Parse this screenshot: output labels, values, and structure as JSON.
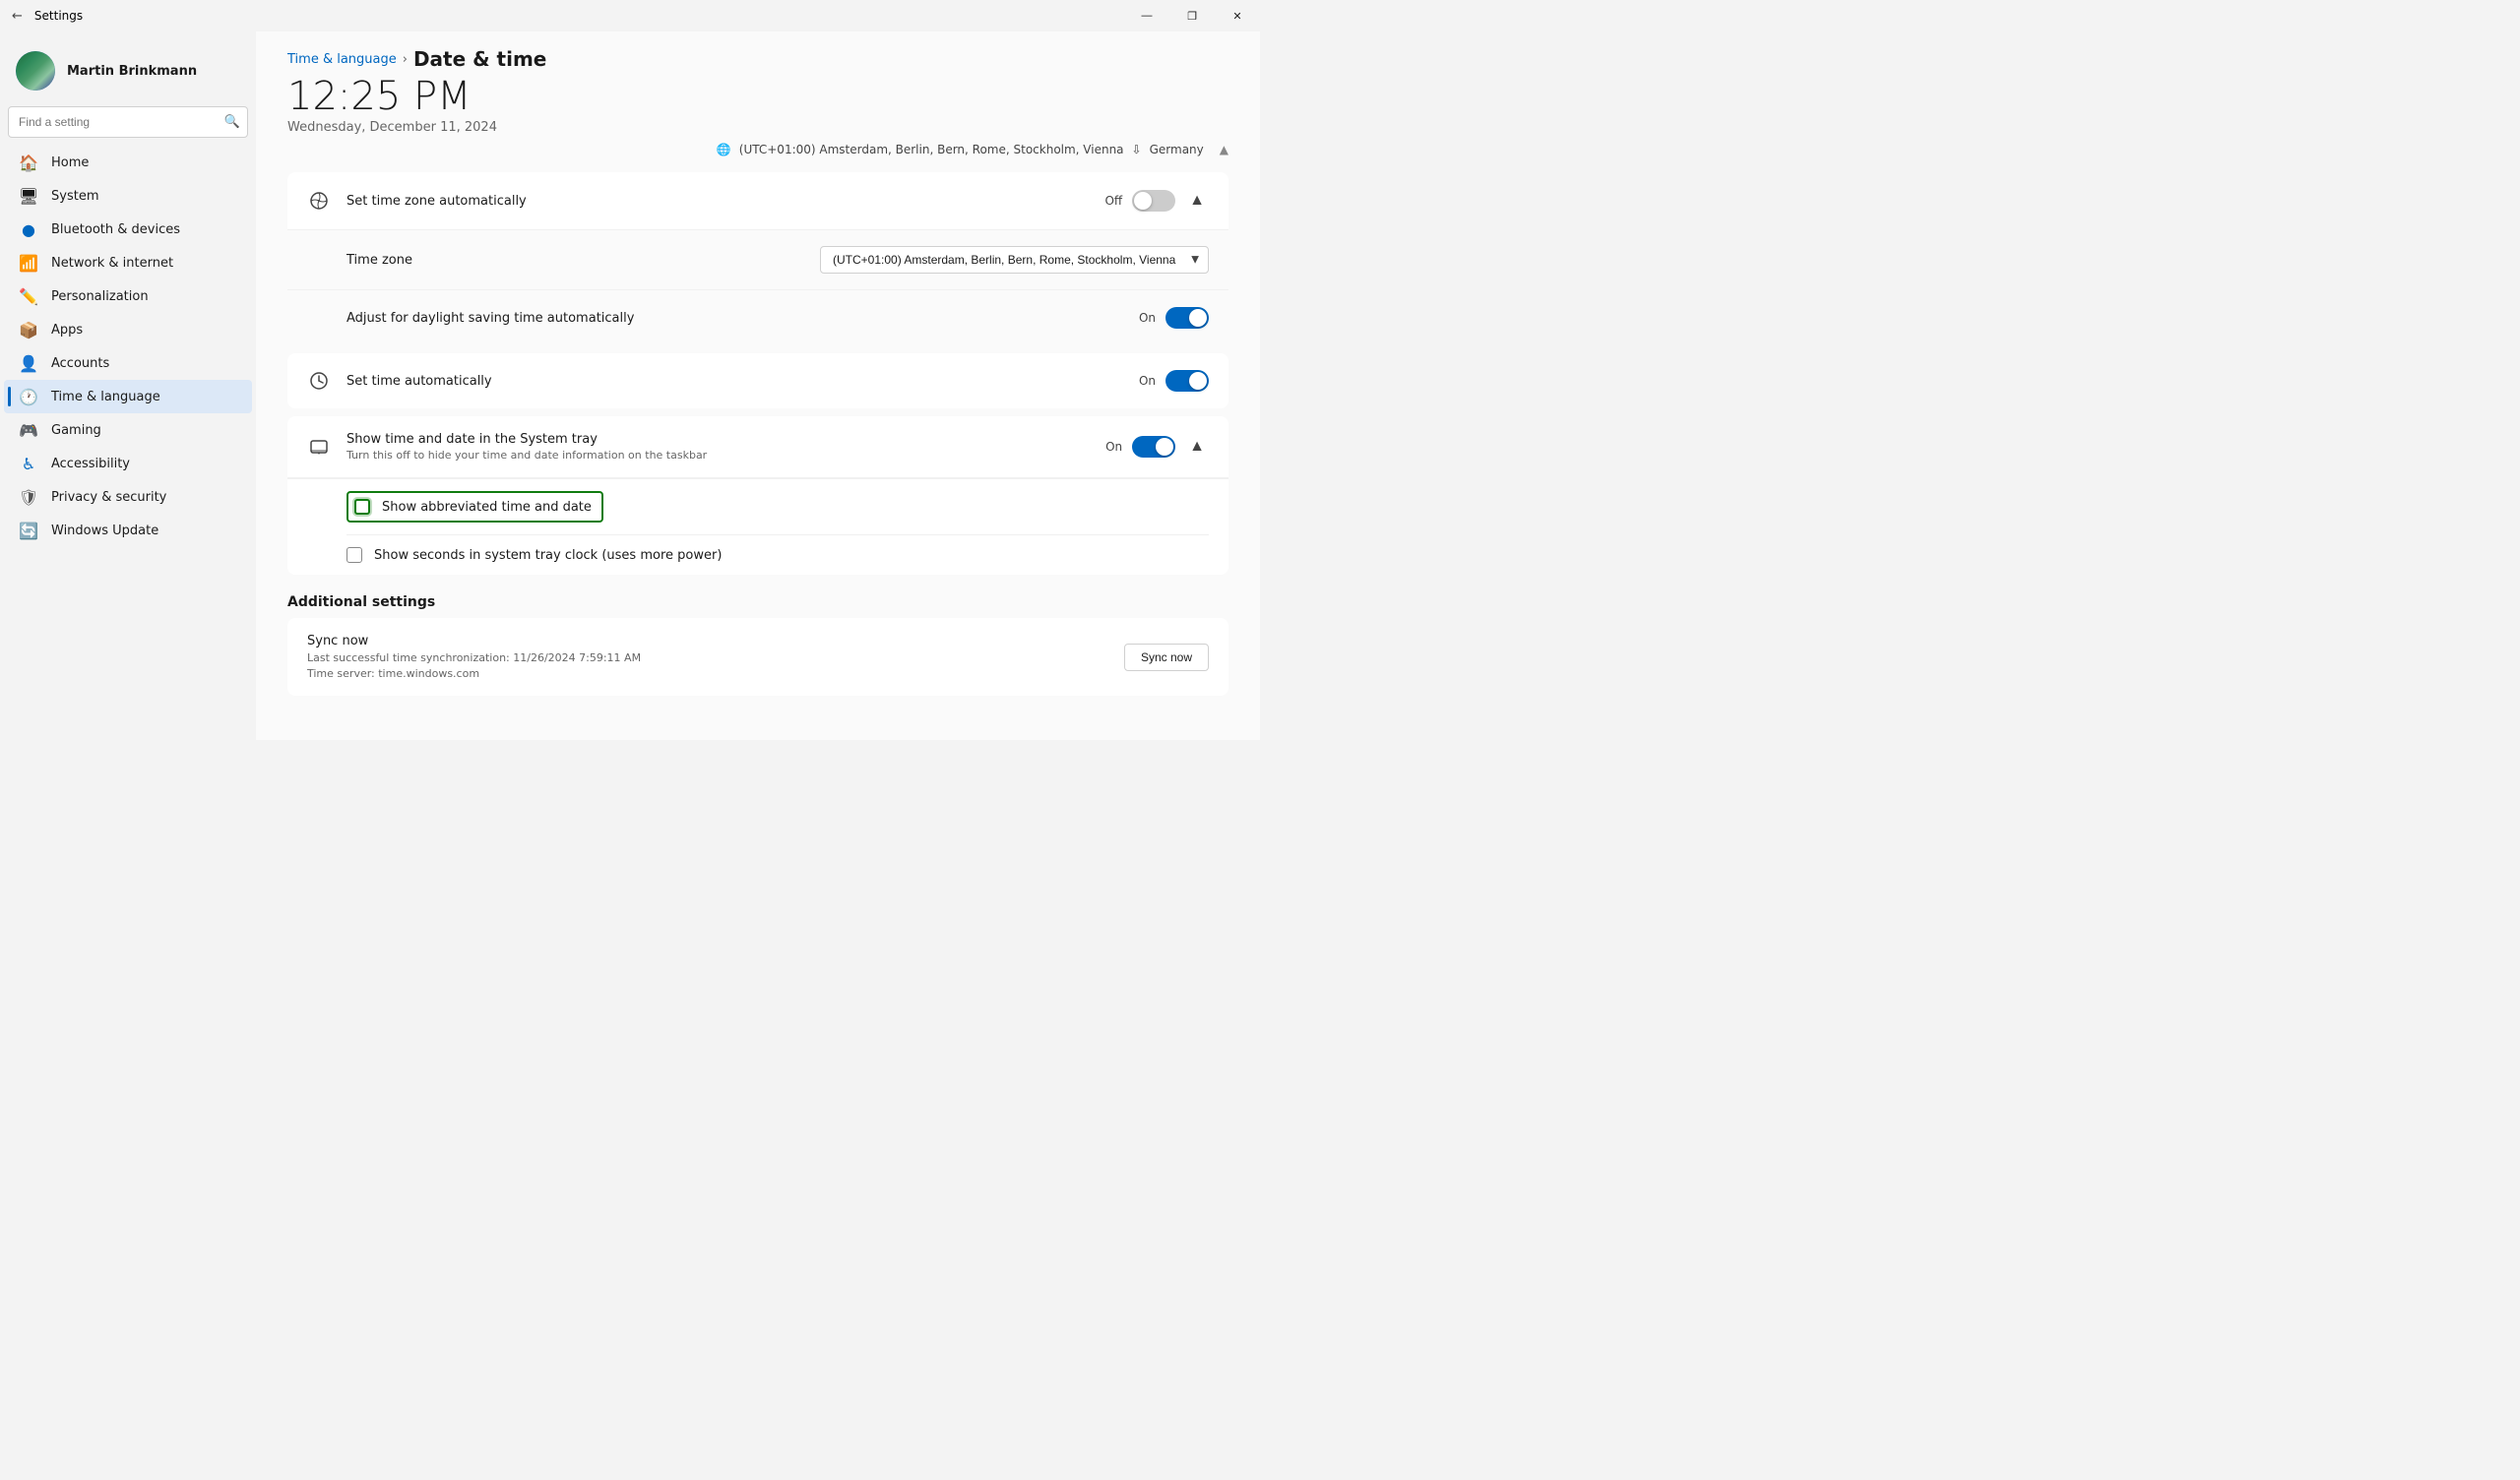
{
  "titlebar": {
    "title": "Settings",
    "minimize": "—",
    "maximize": "❐",
    "close": "✕"
  },
  "user": {
    "name": "Martin Brinkmann"
  },
  "search": {
    "placeholder": "Find a setting"
  },
  "nav": {
    "items": [
      {
        "id": "home",
        "label": "Home",
        "icon": "🏠"
      },
      {
        "id": "system",
        "label": "System",
        "icon": "🖥"
      },
      {
        "id": "bluetooth",
        "label": "Bluetooth & devices",
        "icon": "🔵"
      },
      {
        "id": "network",
        "label": "Network & internet",
        "icon": "📶"
      },
      {
        "id": "personalization",
        "label": "Personalization",
        "icon": "✏️"
      },
      {
        "id": "apps",
        "label": "Apps",
        "icon": "📦"
      },
      {
        "id": "accounts",
        "label": "Accounts",
        "icon": "👤"
      },
      {
        "id": "time-language",
        "label": "Time & language",
        "icon": "🕐",
        "active": true
      },
      {
        "id": "gaming",
        "label": "Gaming",
        "icon": "🎮"
      },
      {
        "id": "accessibility",
        "label": "Accessibility",
        "icon": "♿"
      },
      {
        "id": "privacy-security",
        "label": "Privacy & security",
        "icon": "🛡"
      },
      {
        "id": "windows-update",
        "label": "Windows Update",
        "icon": "🔄"
      }
    ]
  },
  "breadcrumb": {
    "parent": "Time & language",
    "current": "Date & time"
  },
  "header": {
    "current_time": "12:25 PM",
    "current_date": "Wednesday, December 11, 2024",
    "timezone_label": "(UTC+01:00) Amsterdam, Berlin, Bern, Rome, Stockholm, Vienna",
    "region_label": "Germany"
  },
  "settings": {
    "set_time_zone_auto": {
      "label": "Set time zone automatically",
      "status": "Off",
      "on": false
    },
    "time_zone": {
      "label": "Time zone",
      "value": "(UTC+01:00) Amsterdam, Berlin, Bern, Rome, Stockholm, Vienna"
    },
    "daylight_saving": {
      "label": "Adjust for daylight saving time automatically",
      "status": "On",
      "on": true
    },
    "set_time_auto": {
      "label": "Set time automatically",
      "status": "On",
      "on": true
    },
    "system_tray": {
      "label": "Show time and date in the System tray",
      "desc": "Turn this off to hide your time and date information on the taskbar",
      "status": "On",
      "on": true
    },
    "abbreviated_time": {
      "label": "Show abbreviated time and date",
      "checked": false,
      "highlighted": true
    },
    "show_seconds": {
      "label": "Show seconds in system tray clock (uses more power)",
      "checked": false
    }
  },
  "additional": {
    "title": "Additional settings",
    "sync": {
      "title": "Sync now",
      "desc1": "Last successful time synchronization: 11/26/2024 7:59:11 AM",
      "desc2": "Time server: time.windows.com",
      "btn_label": "Sync now"
    }
  }
}
